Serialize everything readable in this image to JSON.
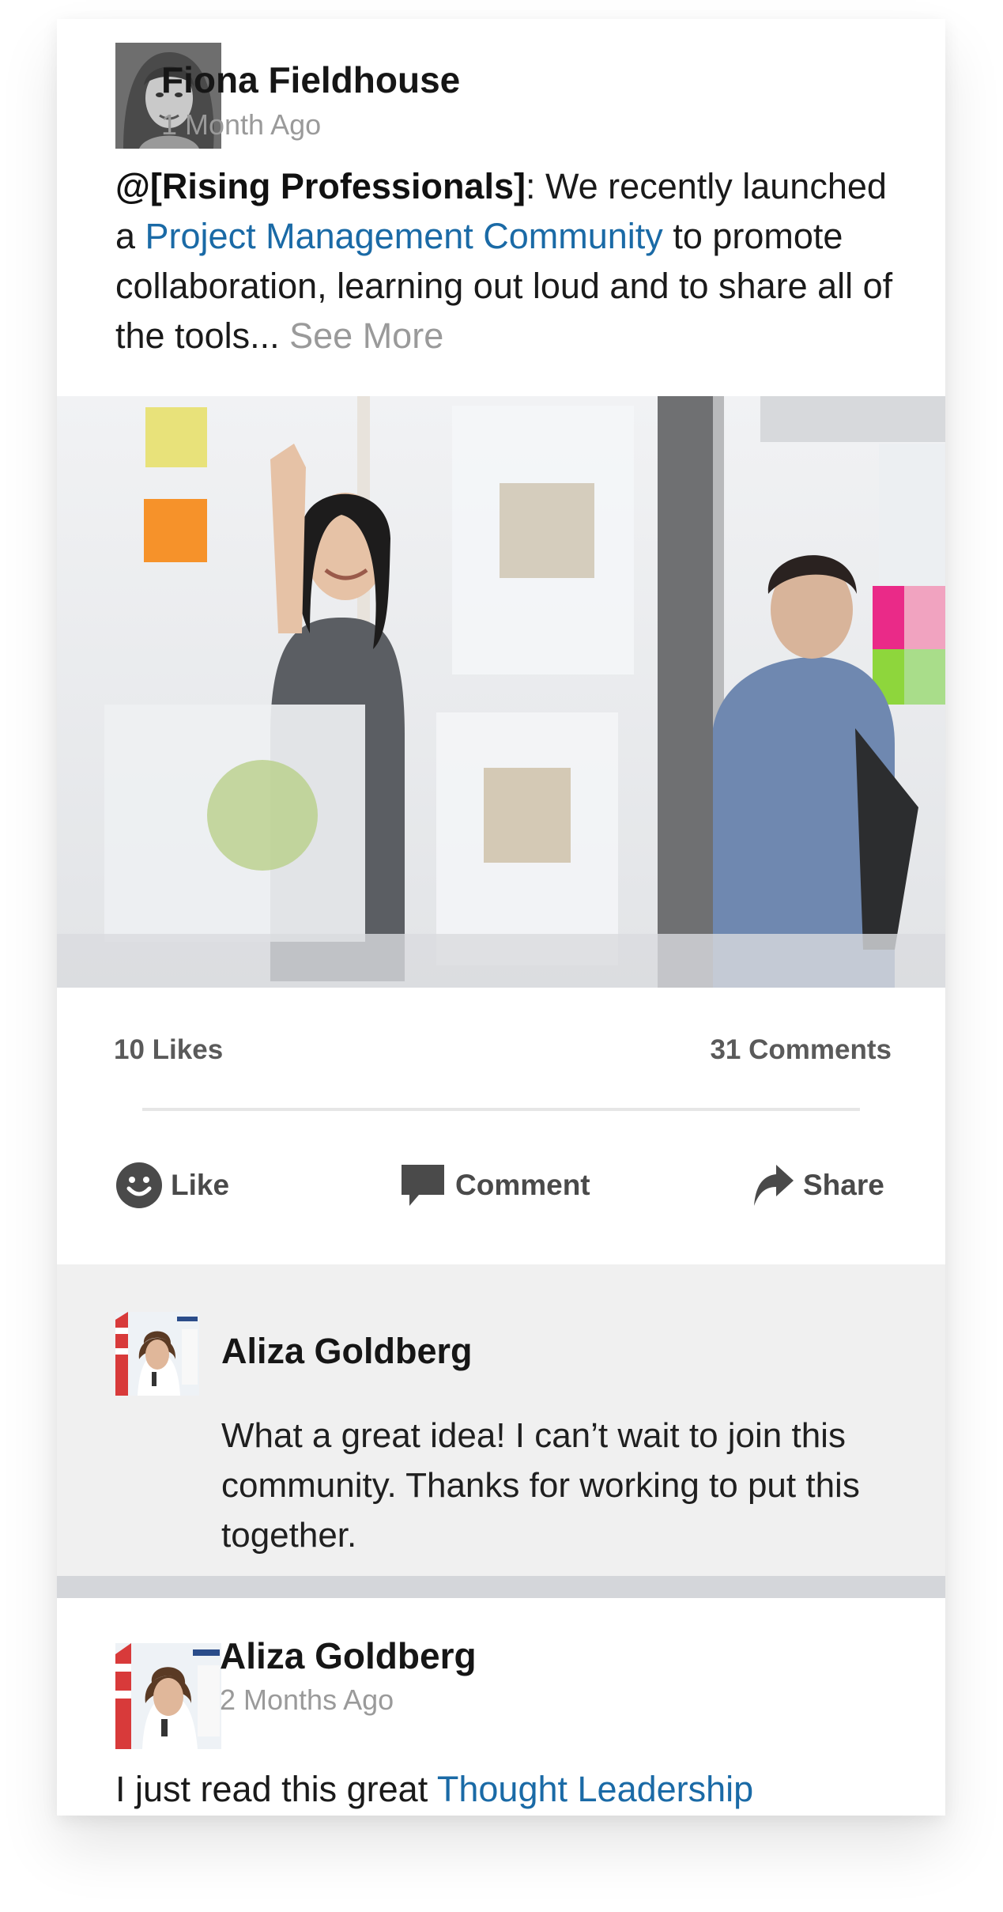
{
  "post": {
    "author": "Fiona Fieldhouse",
    "time": "1 Month Ago",
    "mention": "@[Rising Professionals]",
    "text_before_link": ": We recently launched a ",
    "link_text": "Project Management Community",
    "text_after_link": " to promote collaboration, learning out loud and to share all of the tools... ",
    "see_more": "See More",
    "image_description": "office-collaboration-photo"
  },
  "stats": {
    "likes": "10 Likes",
    "comments": "31 Comments"
  },
  "actions": {
    "like": "Like",
    "comment": "Comment",
    "share": "Share"
  },
  "comment": {
    "author": "Aliza Goldberg",
    "text": "What a great idea! I can’t wait to join this community. Thanks for working to put this together."
  },
  "next_post": {
    "author": "Aliza Goldberg",
    "time": "2 Months Ago",
    "text_before_link": "I just read this great ",
    "link_text": "Thought Leadership"
  },
  "colors": {
    "link": "#1a6aa6",
    "muted": "#9a9a9a",
    "comment_bg": "#f0f0f0",
    "separator": "#d4d6da"
  },
  "icons": {
    "like": "smiley-icon",
    "comment": "speech-bubble-icon",
    "share": "share-arrow-icon"
  }
}
